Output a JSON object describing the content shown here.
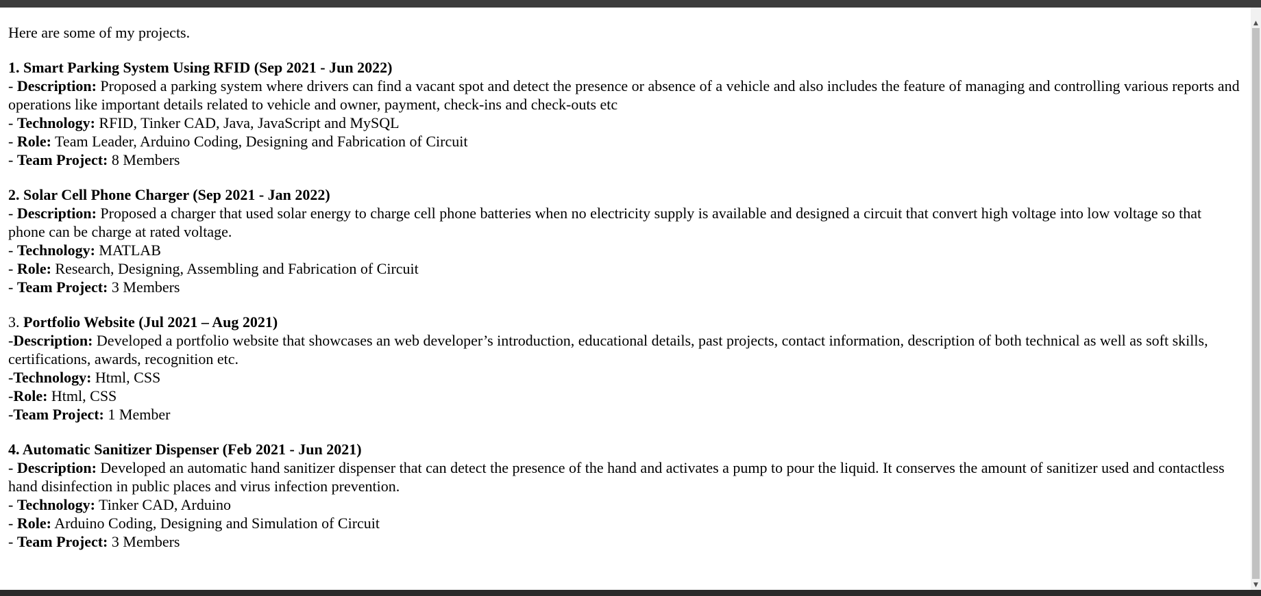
{
  "intro": "Here are some of my projects.",
  "projects": [
    {
      "number": "1.",
      "title": "Smart Parking System Using RFID (Sep 2021 - Jun 2022)",
      "desc_prefix": "- ",
      "desc_label": "Description:",
      "desc_text": "Proposed a parking system where drivers can find a vacant spot and detect the presence or absence of a vehicle and also includes the feature of managing and controlling various reports and operations like important details related to vehicle and owner, payment, check-ins and check-outs etc",
      "tech_prefix": "- ",
      "tech_label": "Technology:",
      "tech_text": "RFID, Tinker CAD, Java, JavaScript and MySQL",
      "role_prefix": "- ",
      "role_label": "Role:",
      "role_text": "Team Leader, Arduino Coding, Designing and Fabrication of Circuit",
      "team_prefix": "- ",
      "team_label": "Team Project:",
      "team_text": "8 Members"
    },
    {
      "number": "2.",
      "title": "Solar Cell Phone Charger (Sep 2021 - Jan 2022)",
      "desc_prefix": "- ",
      "desc_label": "Description:",
      "desc_text": "Proposed a charger that used solar energy to charge cell phone batteries when no electricity supply is available and designed a circuit that convert high voltage into low voltage so that phone can be charge at rated voltage.",
      "tech_prefix": "- ",
      "tech_label": "Technology:",
      "tech_text": "MATLAB",
      "role_prefix": "- ",
      "role_label": "Role:",
      "role_text": "Research, Designing, Assembling and Fabrication of Circuit",
      "team_prefix": "- ",
      "team_label": "Team Project:",
      "team_text": "3 Members"
    },
    {
      "number": "3.",
      "title": "Portfolio Website (Jul 2021 – Aug 2021)",
      "desc_prefix": "-",
      "desc_label": "Description:",
      "desc_text": "Developed a portfolio website that showcases an web developer’s introduction, educational details, past projects, contact information, description of both technical as well as soft skills, certifications, awards, recognition etc.",
      "tech_prefix": "-",
      "tech_label": "Technology:",
      "tech_text": "Html, CSS",
      "role_prefix": "-",
      "role_label": "Role:",
      "role_text": "Html, CSS",
      "team_prefix": "-",
      "team_label": "Team Project:",
      "team_text": "1 Member"
    },
    {
      "number": "4.",
      "title": "Automatic Sanitizer Dispenser (Feb 2021 - Jun 2021)",
      "desc_prefix": "- ",
      "desc_label": "Description:",
      "desc_text": "Developed an automatic hand sanitizer dispenser that can detect the presence of the hand and activates a pump to pour the liquid. It conserves the amount of sanitizer used and contactless hand disinfection in public places and virus infection prevention.",
      "tech_prefix": "- ",
      "tech_label": "Technology:",
      "tech_text": "Tinker CAD, Arduino",
      "role_prefix": "- ",
      "role_label": "Role:",
      "role_text": "Arduino Coding, Designing and Simulation of Circuit",
      "team_prefix": "- ",
      "team_label": "Team Project:",
      "team_text": "3 Members"
    }
  ],
  "scrollbar": {
    "up_arrow": "▲",
    "down_arrow": "▼"
  }
}
